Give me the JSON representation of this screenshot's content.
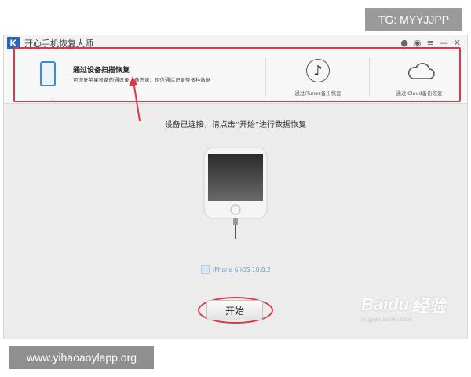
{
  "watermark_top": "TG: MYYJJPP",
  "watermark_bottom": "www.yihaoaoylapp.org",
  "window": {
    "logo_letter": "K",
    "title": "开心手机恢复大师"
  },
  "options": {
    "device": {
      "title": "通过设备扫描恢复",
      "desc": "可恢复苹果设备的通讯录、备忘录、短信通话记录等多种数据"
    },
    "itunes": {
      "label": "通过iTunes备份恢复"
    },
    "icloud": {
      "label": "通过iCloud备份恢复"
    }
  },
  "status_text": "设备已连接，请点击“开始”进行数据恢复",
  "device_name": "iPhone 6 iOS 10.0.2",
  "start_button": "开始",
  "baidu": {
    "logo": "Baidu",
    "jingyan": "经验",
    "sub": "jingyan.baidu.com"
  },
  "colors": {
    "highlight": "#d9384a",
    "accent": "#3a8ad6"
  }
}
